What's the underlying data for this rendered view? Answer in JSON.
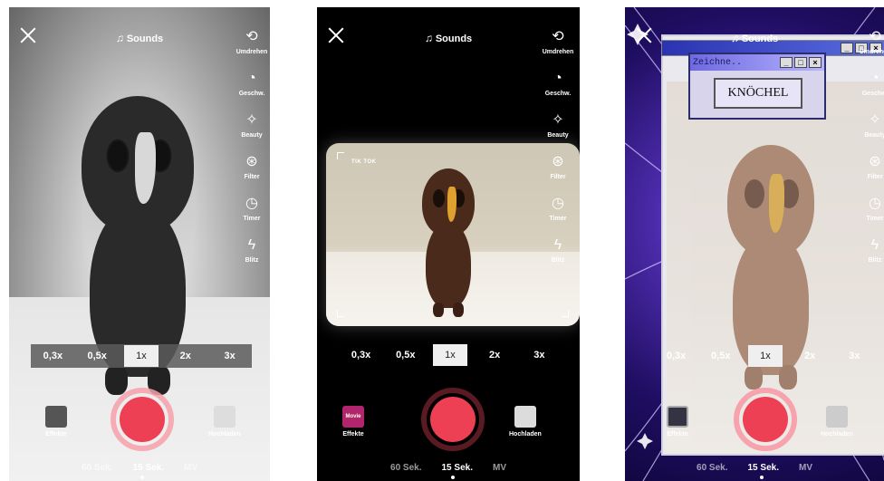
{
  "phones": [
    {
      "sounds": "Sounds",
      "tools": [
        "Umdrehen",
        "Geschw.",
        "Beauty",
        "Filter",
        "Timer",
        "Blitz"
      ],
      "zoom": [
        "0,3x",
        "0,5x",
        "1x",
        "2x",
        "3x"
      ],
      "left_label": "Effekte",
      "right_label": "Hochladen",
      "modes": [
        "60 Sek.",
        "15 Sek.",
        "MV"
      ]
    },
    {
      "sounds": "Sounds",
      "tools": [
        "Umdrehen",
        "Geschw.",
        "Beauty",
        "Filter",
        "Timer",
        "Blitz"
      ],
      "zoom": [
        "0,3x",
        "0,5x",
        "1x",
        "2x",
        "3x"
      ],
      "left_label": "Effekte",
      "left_thumb": "Movie",
      "right_label": "Hochladen",
      "modes": [
        "60 Sek.",
        "15 Sek.",
        "MV"
      ],
      "watermark": "TIK TOK"
    },
    {
      "sounds": "Sounds",
      "tools": [
        "Umdrehen",
        "Geschw.",
        "Beauty",
        "Filter",
        "Timer",
        "Blitz"
      ],
      "zoom": [
        "0,3x",
        "0,5x",
        "1x",
        "2x",
        "3x"
      ],
      "left_label": "Effekte",
      "right_label": "Hochladen",
      "modes": [
        "60 Sek.",
        "15 Sek.",
        "MV"
      ],
      "dialog_title": "Zeichne..",
      "dialog_button": "KNÖCHEL"
    }
  ],
  "selected_zoom": "1x",
  "active_mode": "15 Sek.",
  "colors": {
    "record": "#ee4055",
    "ring": "#f6a0aa",
    "tunnel": "#4b2aa8"
  },
  "icons": [
    "close-icon",
    "music-note-icon",
    "flip-camera-icon",
    "speed-icon",
    "beauty-icon",
    "filter-icon",
    "timer-icon",
    "flash-icon"
  ]
}
